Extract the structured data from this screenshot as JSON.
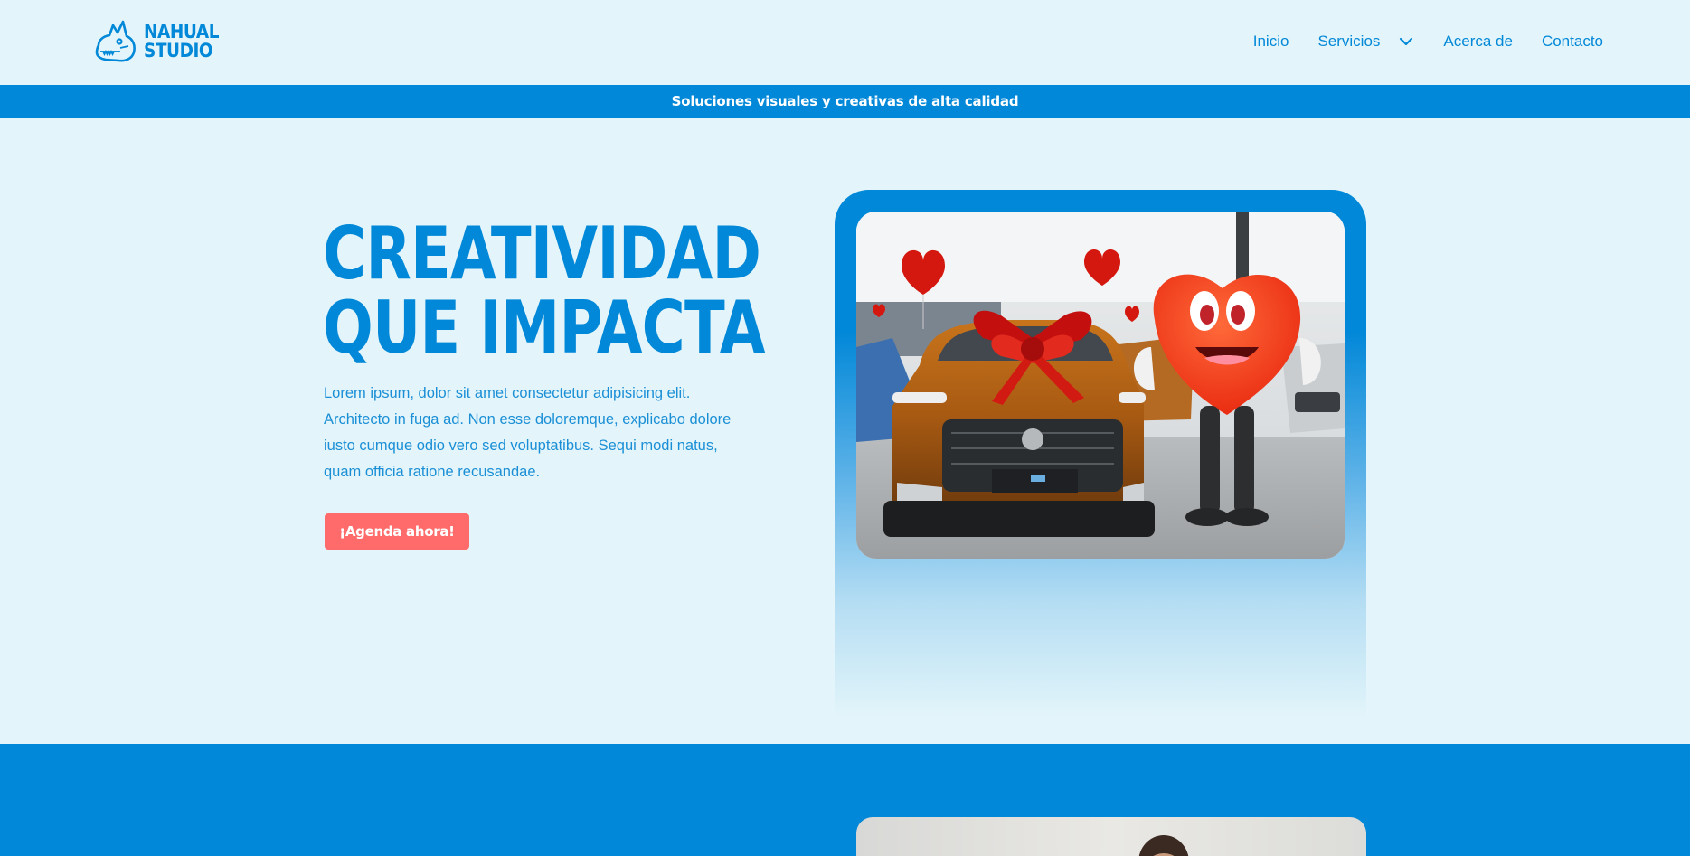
{
  "header": {
    "logo": {
      "line1": "NAHUAL",
      "line2": "STUDIO",
      "icon": "wolf-head-logo"
    },
    "nav": {
      "inicio": "Inicio",
      "servicios": "Servicios",
      "acerca": "Acerca de",
      "contacto": "Contacto",
      "servicios_icon": "chevron-down-icon"
    }
  },
  "announcement": "Soluciones visuales y creativas de alta calidad",
  "hero": {
    "title_line1": "CREATIVIDAD",
    "title_line2": "QUE IMPACTA",
    "body": "Lorem ipsum, dolor sit amet consectetur adipisicing elit. Architecto in fuga ad. Non esse doloremque, explicabo dolore iusto cumque odio vero sed voluptatibus. Sequi modi natus, quam officia ratione recusandae.",
    "cta": "¡Agenda ahora!"
  },
  "colors": {
    "brand_blue": "#0288d8",
    "background": "#e3f5fa",
    "cta": "#ff6b6b",
    "text_on_blue": "#ffffff"
  }
}
